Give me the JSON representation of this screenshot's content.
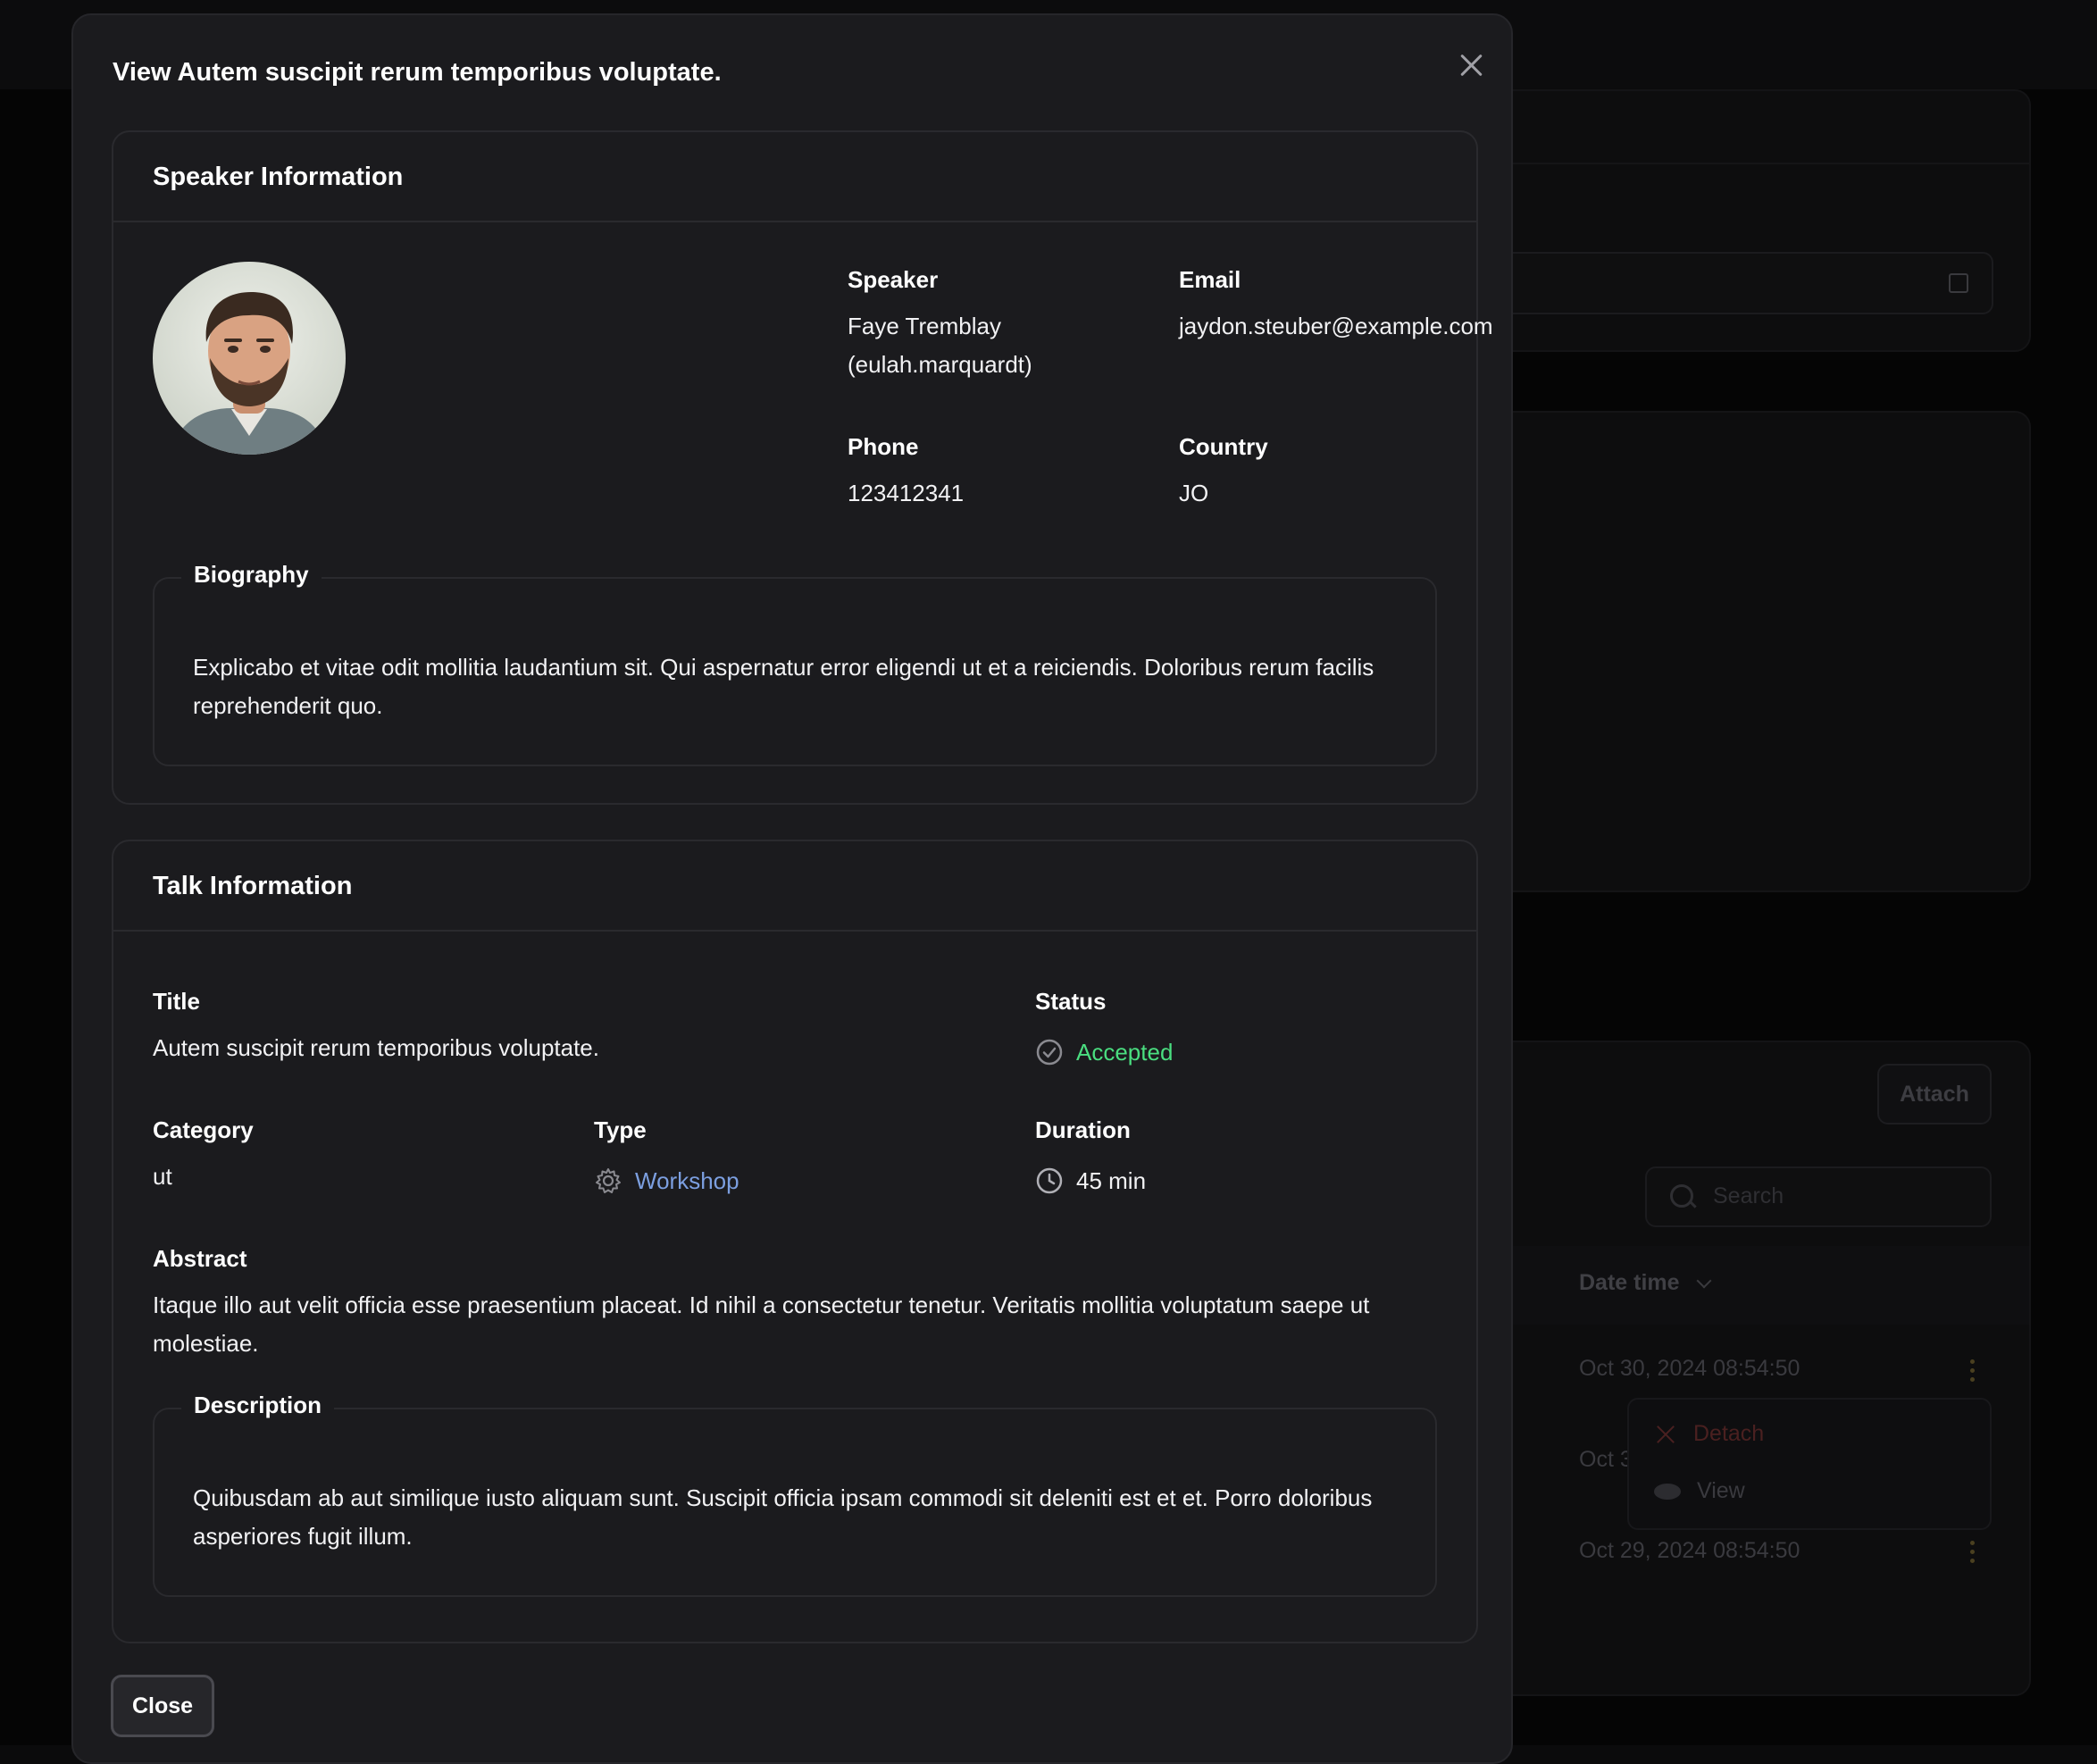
{
  "background": {
    "attach_label": "Attach",
    "search_placeholder": "Search",
    "column_header": "Date time",
    "rows": [
      "Oct 30, 2024 08:54:50",
      "Oct 3",
      "Oct 29, 2024 08:54:50"
    ],
    "menu": {
      "detach_label": "Detach",
      "view_label": "View"
    }
  },
  "modal": {
    "title": "View Autem suscipit rerum temporibus voluptate.",
    "close_button_label": "Close"
  },
  "speaker_section": {
    "title": "Speaker Information",
    "speaker_label": "Speaker",
    "speaker_name": "Faye Tremblay",
    "speaker_username": "(eulah.marquardt)",
    "email_label": "Email",
    "email_value": "jaydon.steuber@example.com",
    "phone_label": "Phone",
    "phone_value": "123412341",
    "country_label": "Country",
    "country_value": "JO",
    "biography_label": "Biography",
    "biography_text": "Explicabo et vitae odit mollitia laudantium sit. Qui aspernatur error eligendi ut et a reiciendis. Doloribus rerum facilis reprehenderit quo."
  },
  "talk_section": {
    "title": "Talk Information",
    "title_label": "Title",
    "title_value": "Autem suscipit rerum temporibus voluptate.",
    "status_label": "Status",
    "status_value": "Accepted",
    "category_label": "Category",
    "category_value": "ut",
    "type_label": "Type",
    "type_value": "Workshop",
    "duration_label": "Duration",
    "duration_value": "45 min",
    "abstract_label": "Abstract",
    "abstract_text": "Itaque illo aut velit officia esse praesentium placeat. Id nihil a consectetur tenetur. Veritatis mollitia voluptatum saepe ut molestiae.",
    "description_label": "Description",
    "description_text": "Quibusdam ab aut similique iusto aliquam sunt. Suscipit officia ipsam commodi sit deleniti est et et. Porro doloribus asperiores fugit illum."
  },
  "colors": {
    "status_accepted": "#4ade80",
    "type_link": "#7c9fe0",
    "modal_bg": "#1b1b1e"
  }
}
